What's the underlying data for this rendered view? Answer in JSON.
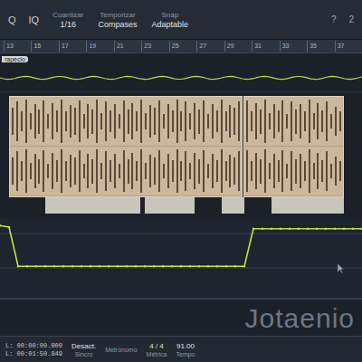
{
  "toolbar": {
    "icons": [
      "Q",
      "IQ"
    ],
    "fields": [
      {
        "label": "Cuantizar",
        "value": "1/16"
      },
      {
        "label": "Temporizar",
        "value": "Compases"
      },
      {
        "label": "Snap",
        "value": "Adaptable"
      }
    ],
    "right_icons": [
      "?",
      "2"
    ]
  },
  "ruler": [
    "13",
    "15",
    "17",
    "19",
    "21",
    "23",
    "25",
    "27",
    "29",
    "31",
    "33",
    "35",
    "37"
  ],
  "track_label": "rapecio",
  "clips": [
    {
      "waveform": [
        0.55,
        0.8,
        0.4,
        0.9,
        0.35,
        0.7,
        0.5,
        0.85,
        0.3,
        0.75,
        0.45,
        0.9,
        0.4,
        0.65,
        0.55,
        0.85,
        0.3,
        0.7,
        0.5,
        0.9,
        0.35,
        0.8,
        0.45,
        0.7,
        0.3,
        0.85,
        0.5,
        0.75,
        0.4,
        0.9,
        0.35,
        0.65,
        0.55,
        0.85,
        0.3,
        0.7,
        0.45,
        0.9,
        0.4,
        0.8,
        0.35,
        0.75,
        0.5,
        0.85,
        0.3,
        0.7,
        0.45,
        0.9,
        0.4,
        0.65,
        0.55,
        0.8
      ]
    },
    {
      "waveform": [
        0.85,
        0.4,
        0.75,
        0.5,
        0.9,
        0.35,
        0.7,
        0.45,
        0.85,
        0.3,
        0.8,
        0.5,
        0.7,
        0.4,
        0.9,
        0.35,
        0.75,
        0.45,
        0.8,
        0.3,
        0.6,
        0.4
      ]
    }
  ],
  "automation": {
    "values": [
      0.92,
      0.9,
      0.42,
      0.42,
      0.42,
      0.42,
      0.42,
      0.42,
      0.42,
      0.42,
      0.42,
      0.42,
      0.42,
      0.42,
      0.42,
      0.42,
      0.42,
      0.42,
      0.42,
      0.42,
      0.42,
      0.42,
      0.42,
      0.42,
      0.42,
      0.42,
      0.42,
      0.42,
      0.88,
      0.88,
      0.88,
      0.88,
      0.88,
      0.88,
      0.88,
      0.88,
      0.88,
      0.88,
      0.88,
      0.88,
      0.88
    ]
  },
  "watermark": "Jotaenio",
  "transport": {
    "start": "L: 00:00:00.000",
    "end": "L: 00:01:50.849",
    "sync": {
      "value": "Desact.",
      "label": "Sincro"
    },
    "metronome": "Metrónomo",
    "signature": {
      "value": "4 / 4",
      "label": "Métrica"
    },
    "tempo": {
      "value": "91.00",
      "label": "Tempo"
    }
  }
}
